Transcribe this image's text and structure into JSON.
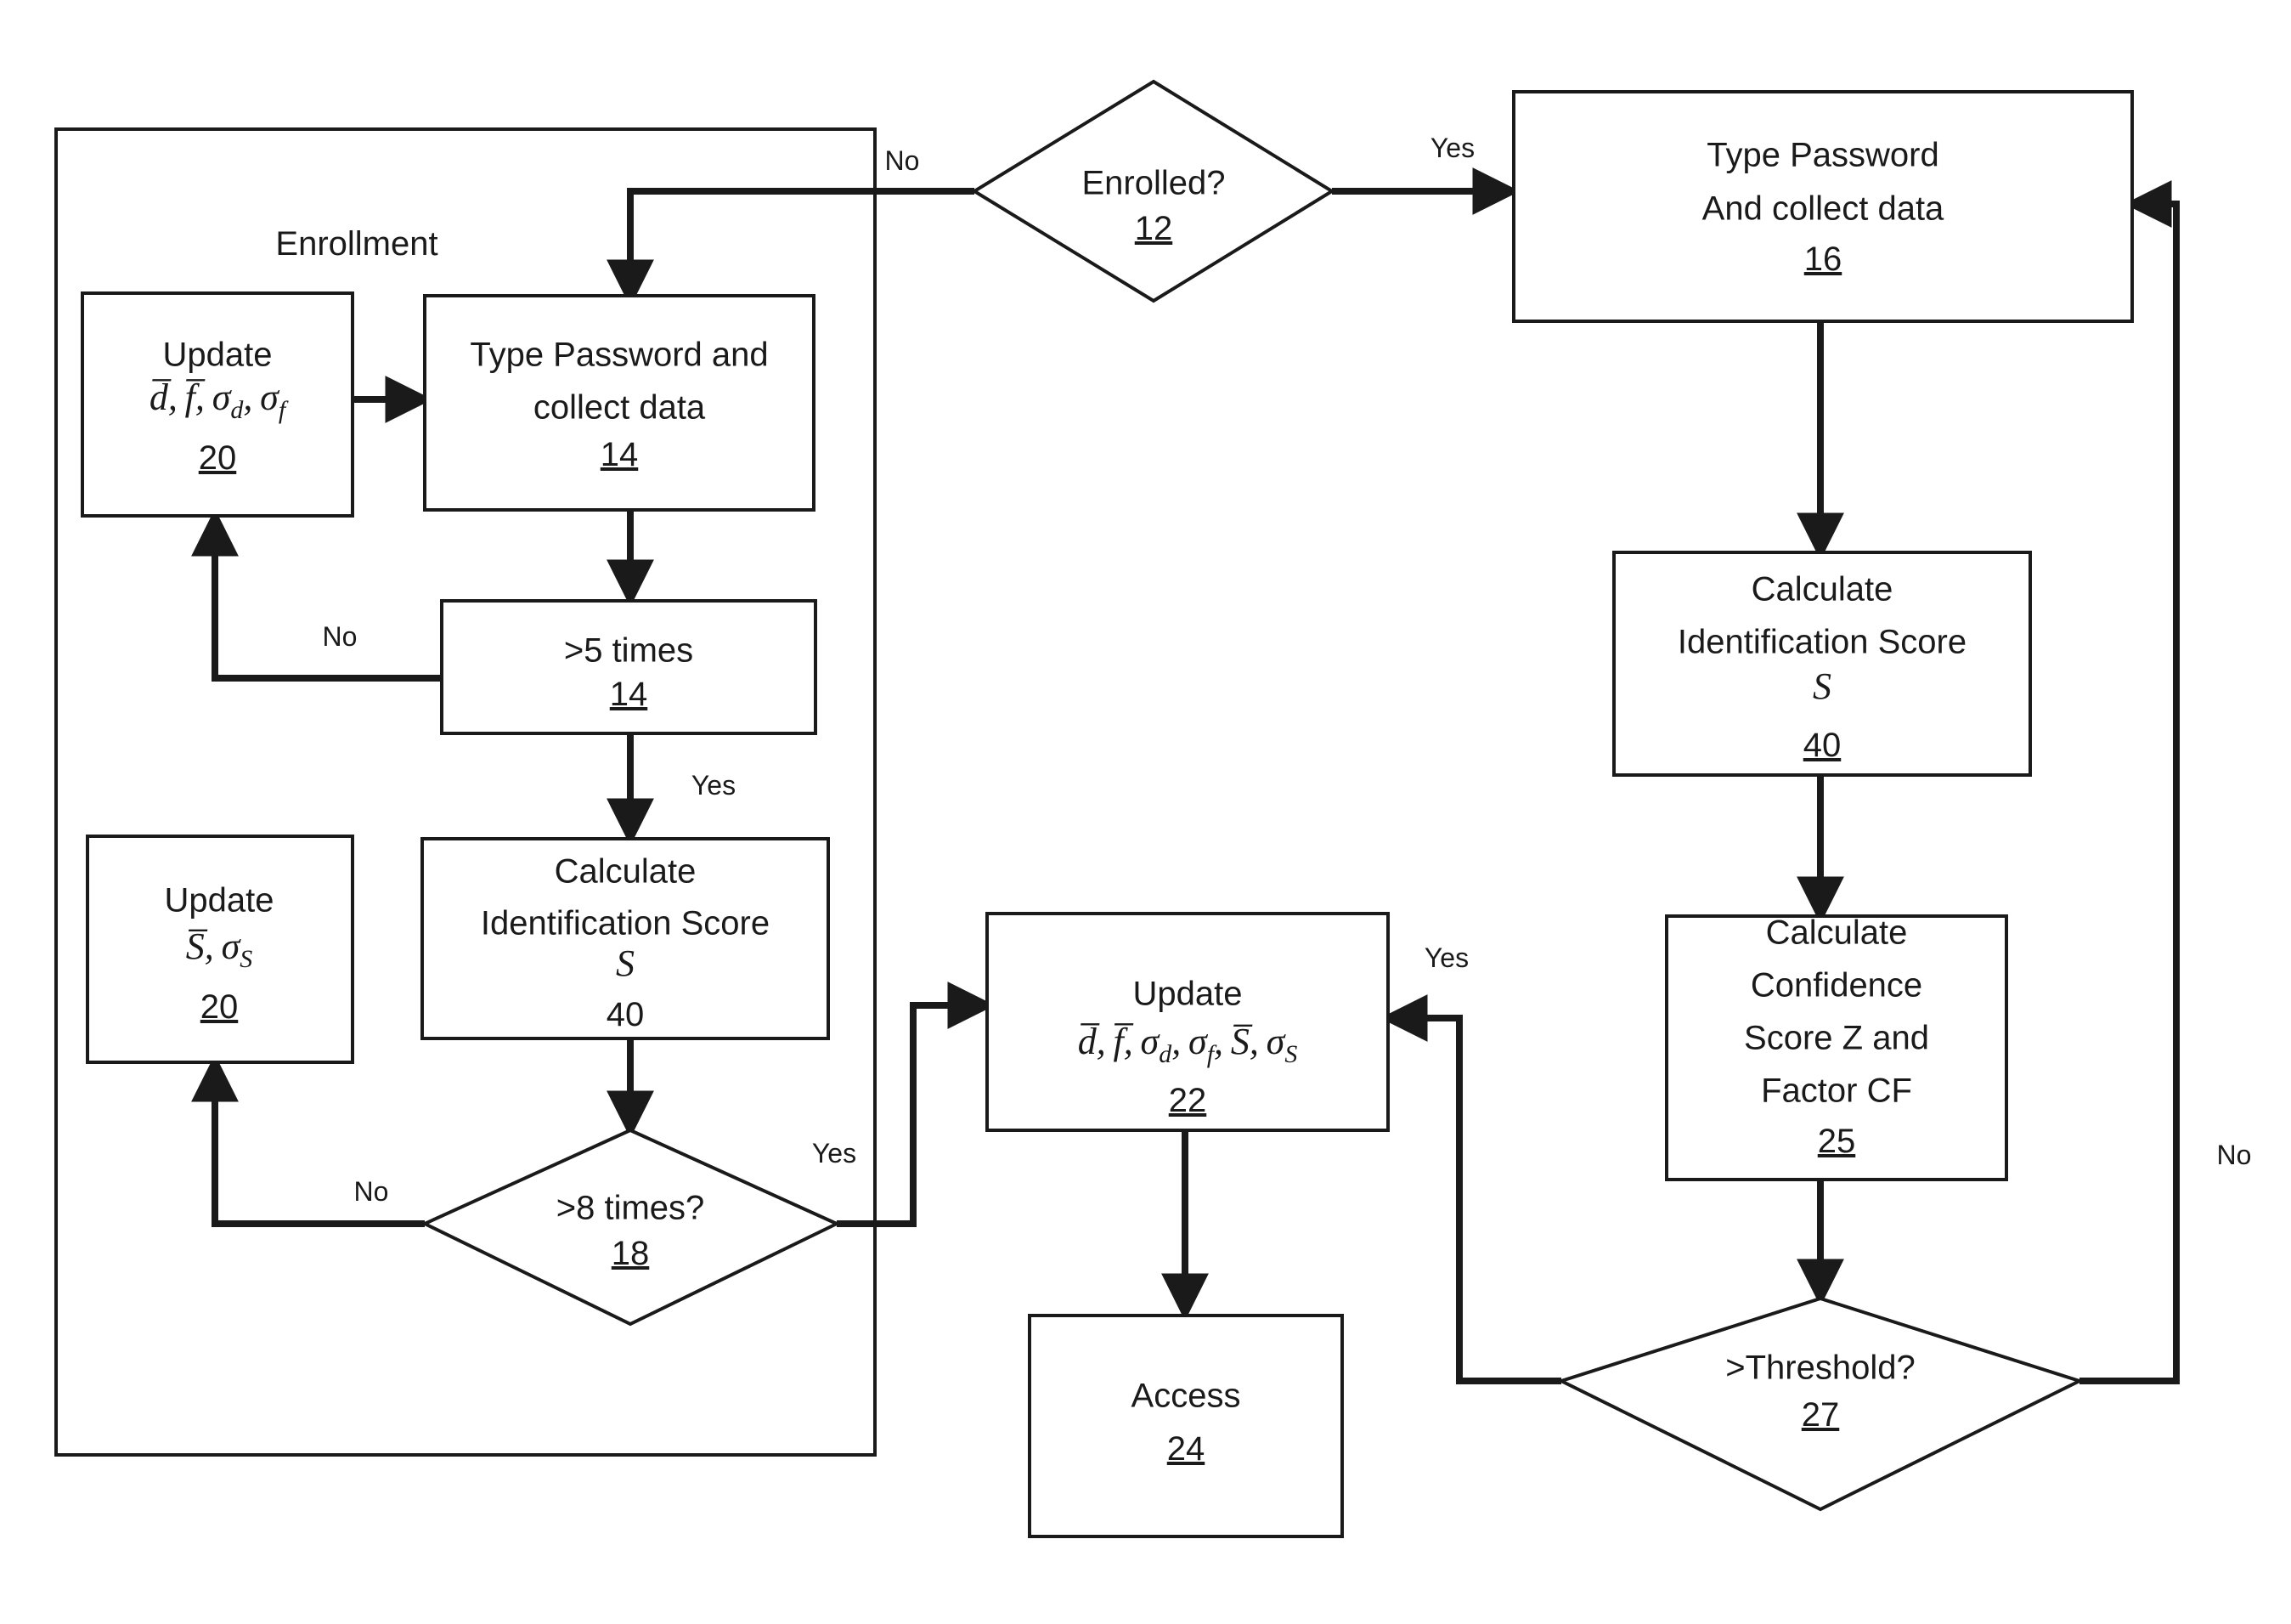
{
  "diagram": {
    "title": "Keystroke dynamics enrollment and authentication flowchart",
    "group_label": "Enrollment",
    "colors": {
      "stroke": "#1a1a1a",
      "fill": "#ffffff"
    }
  },
  "nodes": {
    "enrolled": {
      "shape": "diamond",
      "line1": "Enrolled?",
      "ref": "12",
      "ref_underlined": true
    },
    "type_password_auth": {
      "shape": "rect",
      "line1": "Type Password",
      "line2": "And collect data",
      "ref": "16",
      "ref_underlined": true
    },
    "update_dfsigma": {
      "shape": "rect",
      "line1": "Update",
      "math": "d̄, f̄, σd, σf",
      "math_parts": [
        "d̄,",
        "f̄,",
        "σ",
        "d",
        ",",
        "σ",
        "f"
      ],
      "ref": "20",
      "ref_underlined": true
    },
    "type_password_enroll": {
      "shape": "rect",
      "line1": "Type Password and",
      "line2": "collect data",
      "ref": "14",
      "ref_underlined": true
    },
    "gt5_times": {
      "shape": "rect",
      "line1": ">5 times",
      "ref": "14",
      "ref_underlined": true
    },
    "calc_id_score_enroll": {
      "shape": "rect",
      "line1": "Calculate",
      "line2": "Identification Score",
      "line3": "S",
      "ref": "40",
      "ref_underlined": false
    },
    "update_s_sigmas": {
      "shape": "rect",
      "line1": "Update",
      "math": "S̄, σS",
      "ref": "20",
      "ref_underlined": true
    },
    "gt8_times": {
      "shape": "diamond",
      "line1": ">8 times?",
      "ref": "18",
      "ref_underlined": true
    },
    "update_all": {
      "shape": "rect",
      "line1": "Update",
      "math": "d̄, f̄, σd, σf, S̄, σS",
      "ref": "22",
      "ref_underlined": true
    },
    "access": {
      "shape": "rect",
      "line1": "Access",
      "ref": "24",
      "ref_underlined": true
    },
    "calc_id_score_auth": {
      "shape": "rect",
      "line1": "Calculate",
      "line2": "Identification Score",
      "line3": "S",
      "ref": "40",
      "ref_underlined": true
    },
    "calc_confidence": {
      "shape": "rect",
      "line1": "Calculate",
      "line2": "Confidence",
      "line3": "Score Z and",
      "line4": "Factor CF",
      "ref": "25",
      "ref_underlined": true
    },
    "gt_threshold": {
      "shape": "diamond",
      "line1": ">Threshold?",
      "ref": "27",
      "ref_underlined": true
    }
  },
  "edge_labels": {
    "enrolled_no": "No",
    "enrolled_yes": "Yes",
    "gt5_no": "No",
    "gt5_yes": "Yes",
    "gt8_no": "No",
    "gt8_yes": "Yes",
    "threshold_yes": "Yes",
    "threshold_no": "No"
  }
}
